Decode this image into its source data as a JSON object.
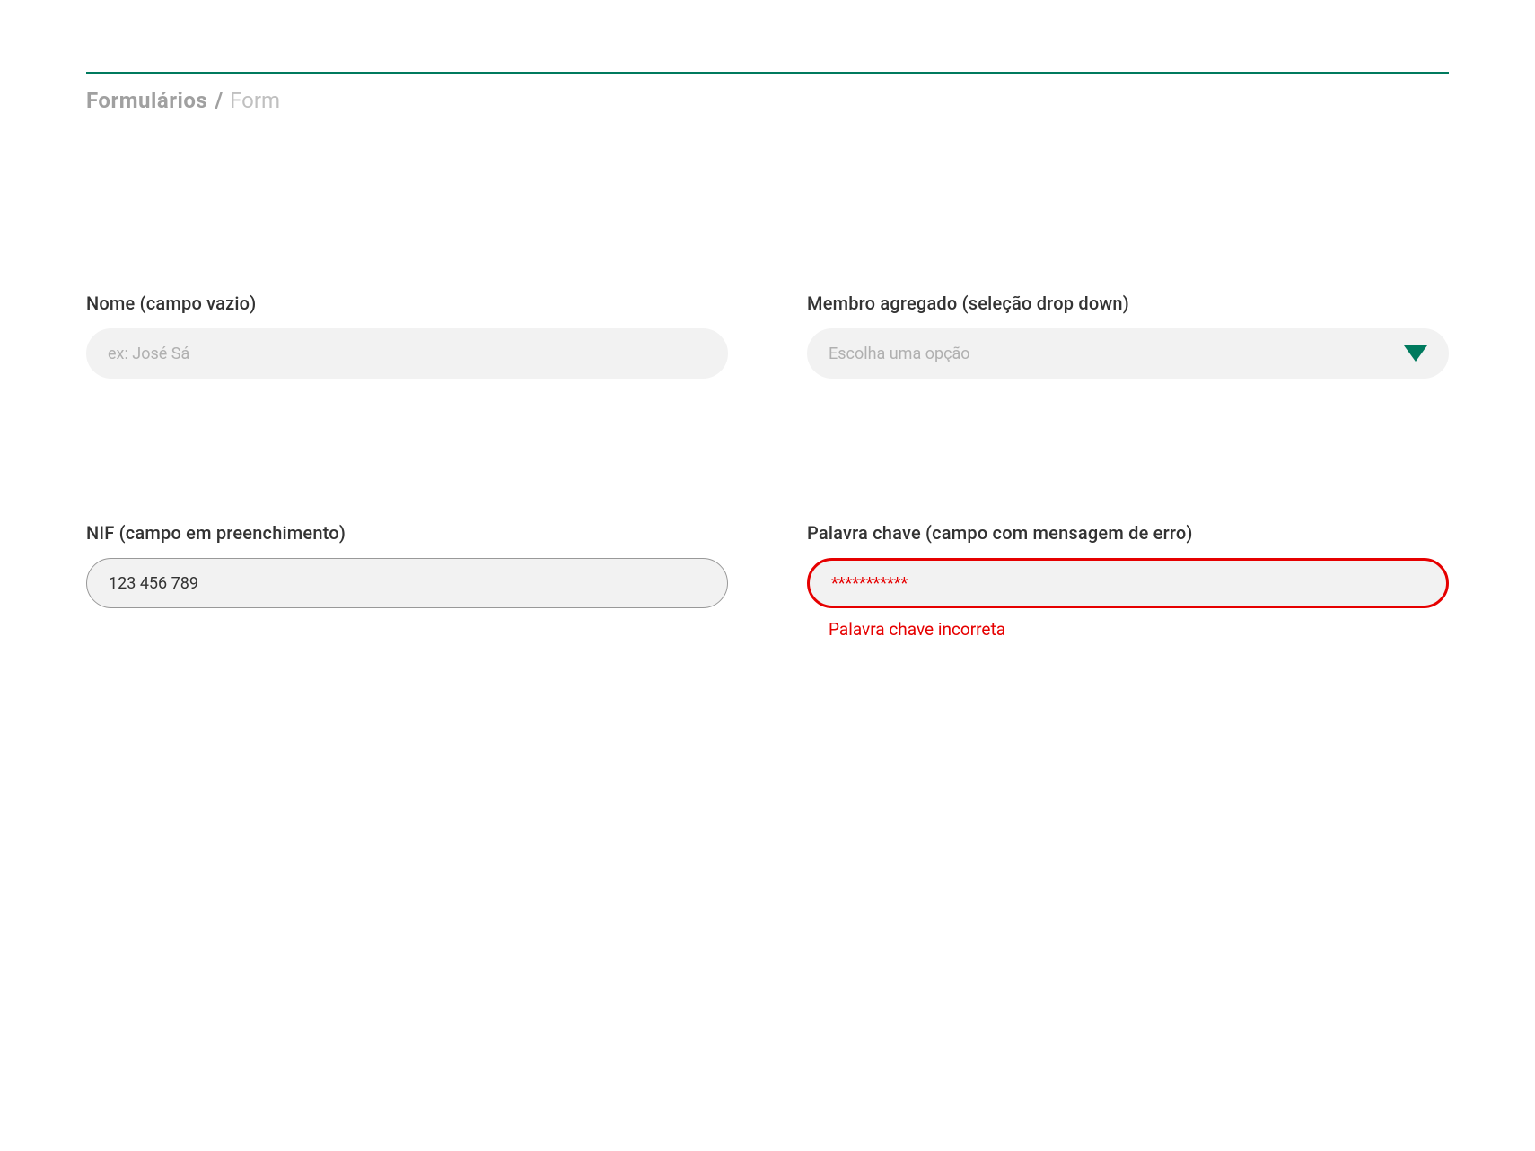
{
  "header": {
    "title_main": "Formulários",
    "title_slash": "/",
    "title_sub": "Form"
  },
  "fields": {
    "nome": {
      "label": "Nome (campo vazio)",
      "placeholder": "ex: José Sá",
      "value": ""
    },
    "membro": {
      "label": "Membro agregado (seleção drop down)",
      "placeholder": "Escolha uma opção",
      "value": ""
    },
    "nif": {
      "label": "NIF (campo em preenchimento)",
      "value": "123 456 789"
    },
    "palavra": {
      "label": "Palavra chave (campo com mensagem de erro)",
      "value": "***********",
      "error": "Palavra chave incorreta"
    }
  },
  "colors": {
    "accent": "#007a5e",
    "error": "#e60000"
  }
}
